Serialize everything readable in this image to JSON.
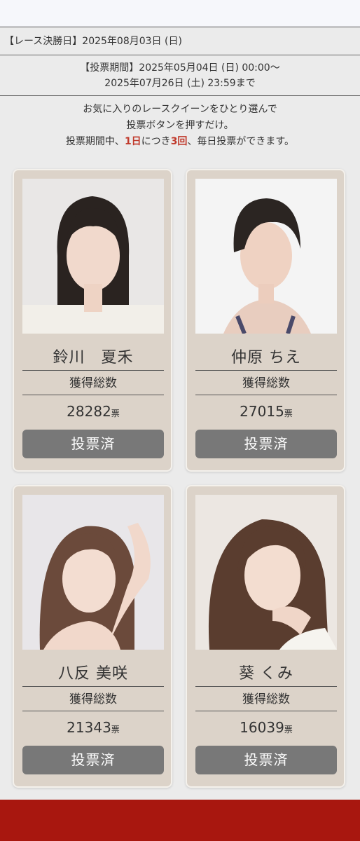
{
  "race_day": "【レース決勝日】2025年08月03日 (日)",
  "vote_period": {
    "line1": "【投票期間】2025年05月04日 (日) 00:00〜",
    "line2": "2025年07月26日 (土) 23:59まで"
  },
  "intro": {
    "line1": "お気に入りのレースクイーンをひとり選んで",
    "line2": "投票ボタンを押すだけ。",
    "line3_pre": "投票期間中、",
    "line3_day": "1日",
    "line3_mid": "につき",
    "line3_times": "3回",
    "line3_post": "、毎日投票ができます。"
  },
  "accent_color": "#c0392b",
  "footer_color": "#a8170f",
  "candidates": [
    {
      "name": "鈴川　夏禾",
      "label": "獲得総数",
      "votes": "28282",
      "unit": "票",
      "button": "投票済",
      "photo": "portrait-photo"
    },
    {
      "name": "仲原 ちえ",
      "label": "獲得総数",
      "votes": "27015",
      "unit": "票",
      "button": "投票済",
      "photo": "portrait-photo"
    },
    {
      "name": "八反 美咲",
      "label": "獲得総数",
      "votes": "21343",
      "unit": "票",
      "button": "投票済",
      "photo": "portrait-photo"
    },
    {
      "name": "葵 くみ",
      "label": "獲得総数",
      "votes": "16039",
      "unit": "票",
      "button": "投票済",
      "photo": "portrait-photo"
    }
  ]
}
